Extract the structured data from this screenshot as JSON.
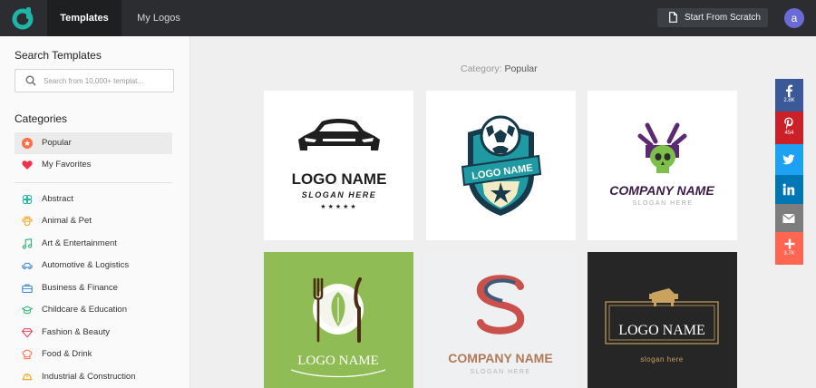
{
  "header": {
    "tabs": [
      {
        "label": "Templates"
      },
      {
        "label": "My Logos"
      }
    ],
    "scratch_label": "Start From Scratch",
    "avatar_letter": "a",
    "brand_color": "#1fb5a6"
  },
  "sidebar": {
    "search_heading": "Search Templates",
    "search_placeholder": "Search from 10,000+ templat...",
    "categories_heading": "Categories",
    "pinned": [
      {
        "label": "Popular",
        "icon": "star-badge-icon"
      },
      {
        "label": "My Favorites",
        "icon": "heart-icon"
      }
    ],
    "items": [
      {
        "label": "Abstract",
        "icon": "abstract-icon"
      },
      {
        "label": "Animal & Pet",
        "icon": "paw-icon"
      },
      {
        "label": "Art & Entertainment",
        "icon": "music-note-icon"
      },
      {
        "label": "Automotive & Logistics",
        "icon": "car-icon"
      },
      {
        "label": "Business & Finance",
        "icon": "briefcase-icon"
      },
      {
        "label": "Childcare & Education",
        "icon": "graduation-cap-icon"
      },
      {
        "label": "Fashion & Beauty",
        "icon": "diamond-icon"
      },
      {
        "label": "Food & Drink",
        "icon": "chef-hat-icon"
      },
      {
        "label": "Industrial & Construction",
        "icon": "hard-hat-icon"
      }
    ]
  },
  "main": {
    "category_prefix": "Category:",
    "category_value": "Popular",
    "templates": [
      {
        "title": "LOGO NAME",
        "subtitle": "SLOGAN HERE"
      },
      {
        "title": "LOGO NAME"
      },
      {
        "title": "COMPANY NAME",
        "subtitle": "SLOGAN HERE"
      },
      {
        "title": "LOGO NAME"
      },
      {
        "title": "COMPANY NAME",
        "subtitle": "SLOGAN HERE"
      },
      {
        "title": "LOGO NAME",
        "subtitle": "slogan here"
      }
    ]
  },
  "social": {
    "facebook_count": "2.8K",
    "pinterest_count": "454",
    "share_count": "3.7K",
    "colors": {
      "facebook": "#3b5998",
      "pinterest": "#cb2027",
      "twitter": "#1da1f2",
      "linkedin": "#0077b5",
      "email": "#7d7d7d",
      "share": "#ff6550"
    }
  }
}
